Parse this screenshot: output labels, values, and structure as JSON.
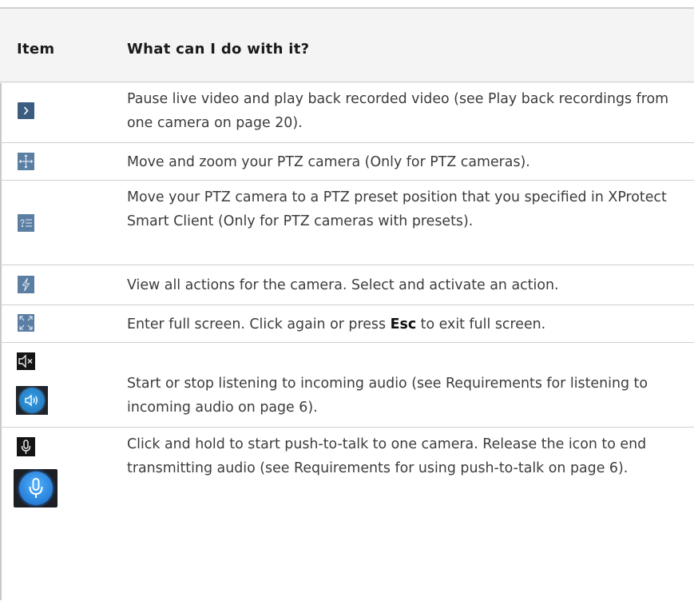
{
  "table": {
    "header": {
      "item": "Item",
      "what": "What can I do with it?"
    },
    "rows": [
      {
        "icon": "play-chevron-icon",
        "text": "Pause live video and play back recorded video (see Play back recordings from one camera on page 20)."
      },
      {
        "icon": "ptz-move-icon",
        "text": "Move and zoom your PTZ camera (Only for PTZ cameras)."
      },
      {
        "icon": "ptz-preset-list-icon",
        "text": "Move your PTZ camera to a PTZ preset position that you specified in XProtect Smart Client (Only for PTZ cameras with presets)."
      },
      {
        "icon": "lightning-actions-icon",
        "text": "View all actions for the camera. Select and activate an action."
      },
      {
        "icon": "fullscreen-icon",
        "text_before": "Enter full screen. Click again or press ",
        "text_bold": "Esc",
        "text_after": " to exit full screen."
      },
      {
        "icon": "speaker-muted-icon",
        "icon2": "speaker-on-icon",
        "text": "Start or stop listening to incoming audio (see Requirements for listening to incoming audio on page 6)."
      },
      {
        "icon": "microphone-icon",
        "icon2": "microphone-active-icon",
        "text": "Click and hold to start push-to-talk to one camera. Release the icon to end transmitting audio (see Requirements for using push-to-talk on page 6)."
      }
    ]
  },
  "colors": {
    "icon_blue": "#3a5d80",
    "header_bg": "#f4f4f4",
    "border": "#cfcfcf"
  }
}
